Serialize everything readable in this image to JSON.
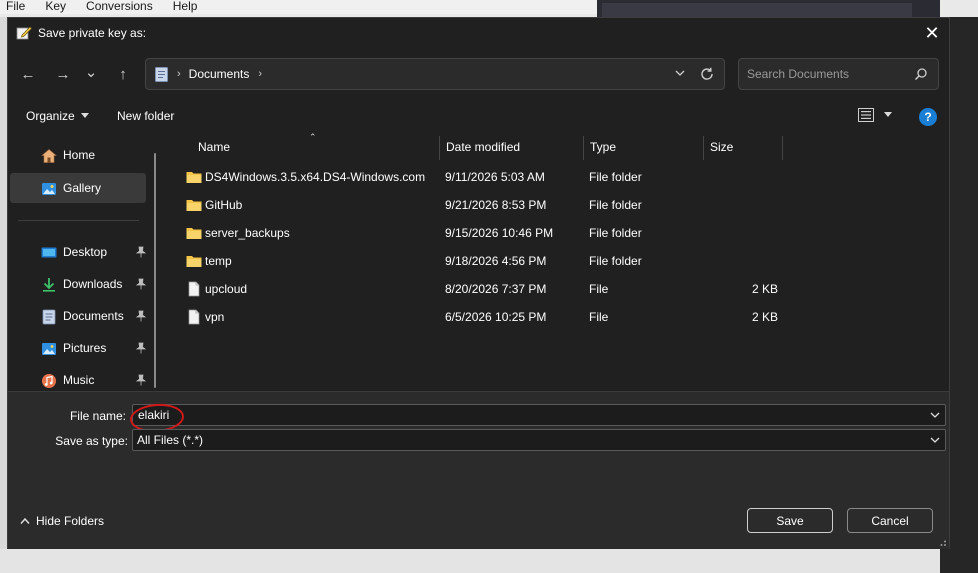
{
  "background": {
    "menu": [
      "File",
      "Key",
      "Conversions",
      "Help"
    ]
  },
  "dialog": {
    "title": "Save private key as:",
    "close_glyph": "✕"
  },
  "nav": {
    "back_glyph": "←",
    "forward_glyph": "→",
    "recent_glyph": "⌄",
    "up_glyph": "↑",
    "breadcrumb_sep": "›",
    "breadcrumb": [
      "Documents"
    ],
    "search_placeholder": "Search Documents"
  },
  "toolbar": {
    "organize_label": "Organize",
    "new_folder_label": "New folder"
  },
  "sidebar": {
    "items": [
      {
        "label": "Home",
        "icon": "home-icon",
        "pinned": false
      },
      {
        "label": "Gallery",
        "icon": "gallery-icon",
        "pinned": false,
        "selected": true
      },
      {
        "label": "Desktop",
        "icon": "desktop-icon",
        "pinned": true
      },
      {
        "label": "Downloads",
        "icon": "download-icon",
        "pinned": true
      },
      {
        "label": "Documents",
        "icon": "documents-icon",
        "pinned": true
      },
      {
        "label": "Pictures",
        "icon": "pictures-icon",
        "pinned": true
      },
      {
        "label": "Music",
        "icon": "music-icon",
        "pinned": true
      }
    ]
  },
  "files": {
    "columns": [
      "Name",
      "Date modified",
      "Type",
      "Size"
    ],
    "rows": [
      {
        "name": "DS4Windows.3.5.x64.DS4-Windows.com",
        "date": "9/11/2026 5:03 AM",
        "type": "File folder",
        "size": "",
        "icon": "folder-icon"
      },
      {
        "name": "GitHub",
        "date": "9/21/2026 8:53 PM",
        "type": "File folder",
        "size": "",
        "icon": "folder-icon"
      },
      {
        "name": "server_backups",
        "date": "9/15/2026 10:46 PM",
        "type": "File folder",
        "size": "",
        "icon": "folder-icon"
      },
      {
        "name": "temp",
        "date": "9/18/2026 4:56 PM",
        "type": "File folder",
        "size": "",
        "icon": "folder-icon"
      },
      {
        "name": "upcloud",
        "date": "8/20/2026 7:37 PM",
        "type": "File",
        "size": "2 KB",
        "icon": "file-icon"
      },
      {
        "name": "vpn",
        "date": "6/5/2026 10:25 PM",
        "type": "File",
        "size": "2 KB",
        "icon": "file-icon"
      }
    ]
  },
  "bottom": {
    "file_name_label": "File name:",
    "file_name_value": "elakiri",
    "save_type_label": "Save as type:",
    "save_type_value": "All Files (*.*)",
    "hide_folders_label": "Hide Folders",
    "save_label": "Save",
    "cancel_label": "Cancel"
  },
  "colors": {
    "dialog_bg": "#202020",
    "panel_bg": "#2b2b2b",
    "folder": "#f3c445",
    "accent": "#1a7fd4",
    "annotation": "#d01818"
  }
}
